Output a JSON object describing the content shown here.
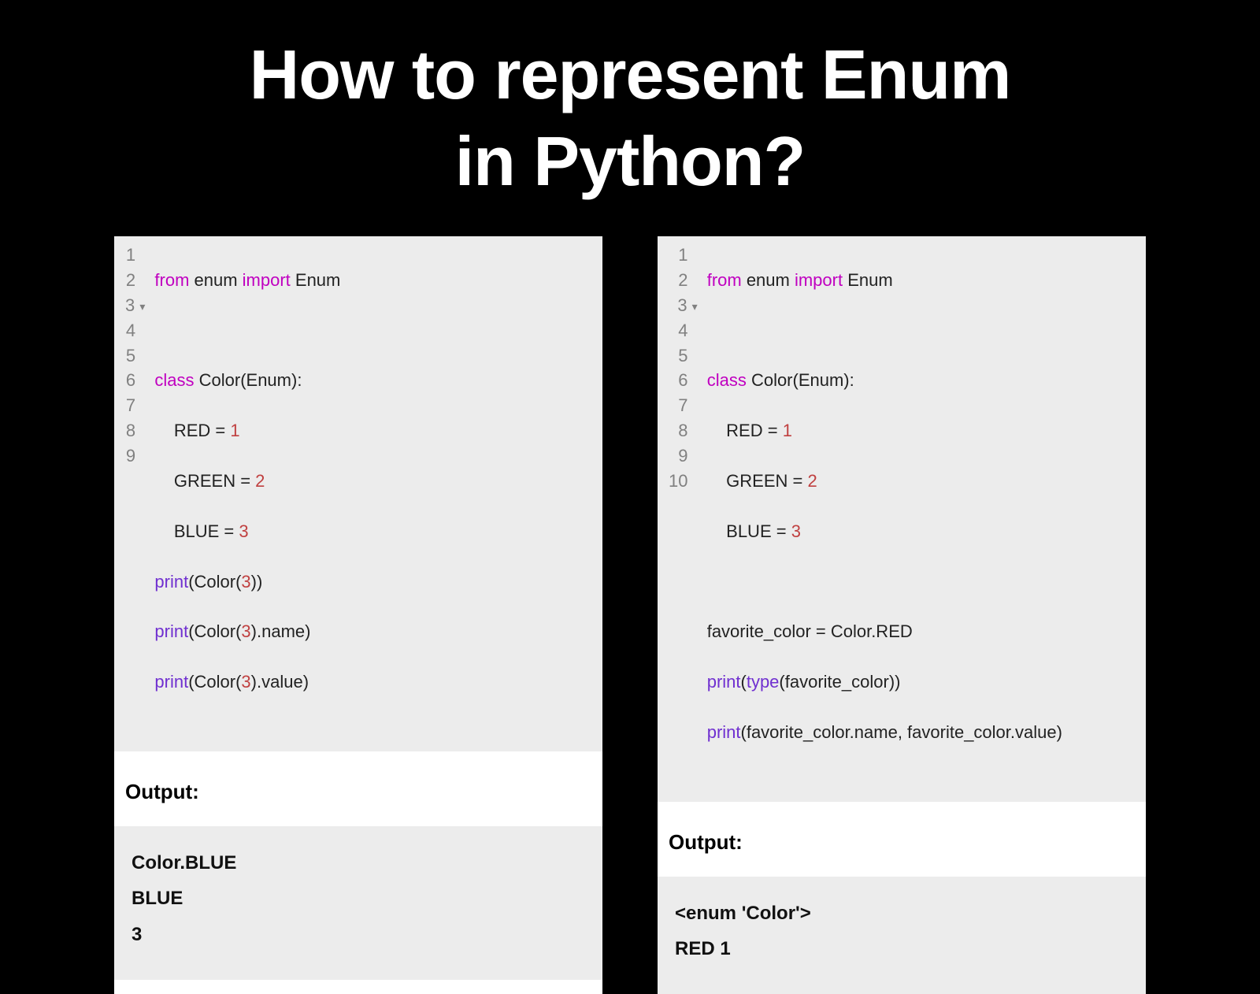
{
  "title_line1": "How to represent Enum",
  "title_line2": "in Python?",
  "left": {
    "lineNumbers": [
      "1",
      "2",
      "3",
      "4",
      "5",
      "6",
      "7",
      "8",
      "9"
    ],
    "foldAt": 3,
    "kw_from": "from",
    "kw_import": "import",
    "kw_class": "class",
    "mod_enum": " enum ",
    "cls_enum": " Enum",
    "class_decl": " Color(Enum):",
    "l4a": "    RED = ",
    "l4n": "1",
    "l5a": "    GREEN = ",
    "l5n": "2",
    "l6a": "    BLUE = ",
    "l6n": "3",
    "fn_print": "print",
    "l7a": "(Color(",
    "l7n": "3",
    "l7b": "))",
    "l8a": "(Color(",
    "l8n": "3",
    "l8b": ").name)",
    "l9a": "(Color(",
    "l9n": "3",
    "l9b": ").value)",
    "outputLabel": "Output:",
    "out1": "Color.BLUE",
    "out2": "BLUE",
    "out3": "3"
  },
  "right": {
    "lineNumbers": [
      "1",
      "2",
      "3",
      "4",
      "5",
      "6",
      "7",
      "8",
      "9",
      "10"
    ],
    "foldAt": 3,
    "kw_from": "from",
    "kw_import": "import",
    "kw_class": "class",
    "mod_enum": " enum ",
    "cls_enum": " Enum",
    "class_decl": " Color(Enum):",
    "l4a": "    RED = ",
    "l4n": "1",
    "l5a": "    GREEN = ",
    "l5n": "2",
    "l6a": "    BLUE = ",
    "l6n": "3",
    "l8": "favorite_color = Color.RED",
    "fn_print": "print",
    "fn_type": "type",
    "l9a": "(",
    "l9b": "(favorite_color))",
    "l10a": "(favorite_color.name, favorite_color.value)",
    "outputLabel": "Output:",
    "out1": "<enum 'Color'>",
    "out2": "RED 1"
  }
}
